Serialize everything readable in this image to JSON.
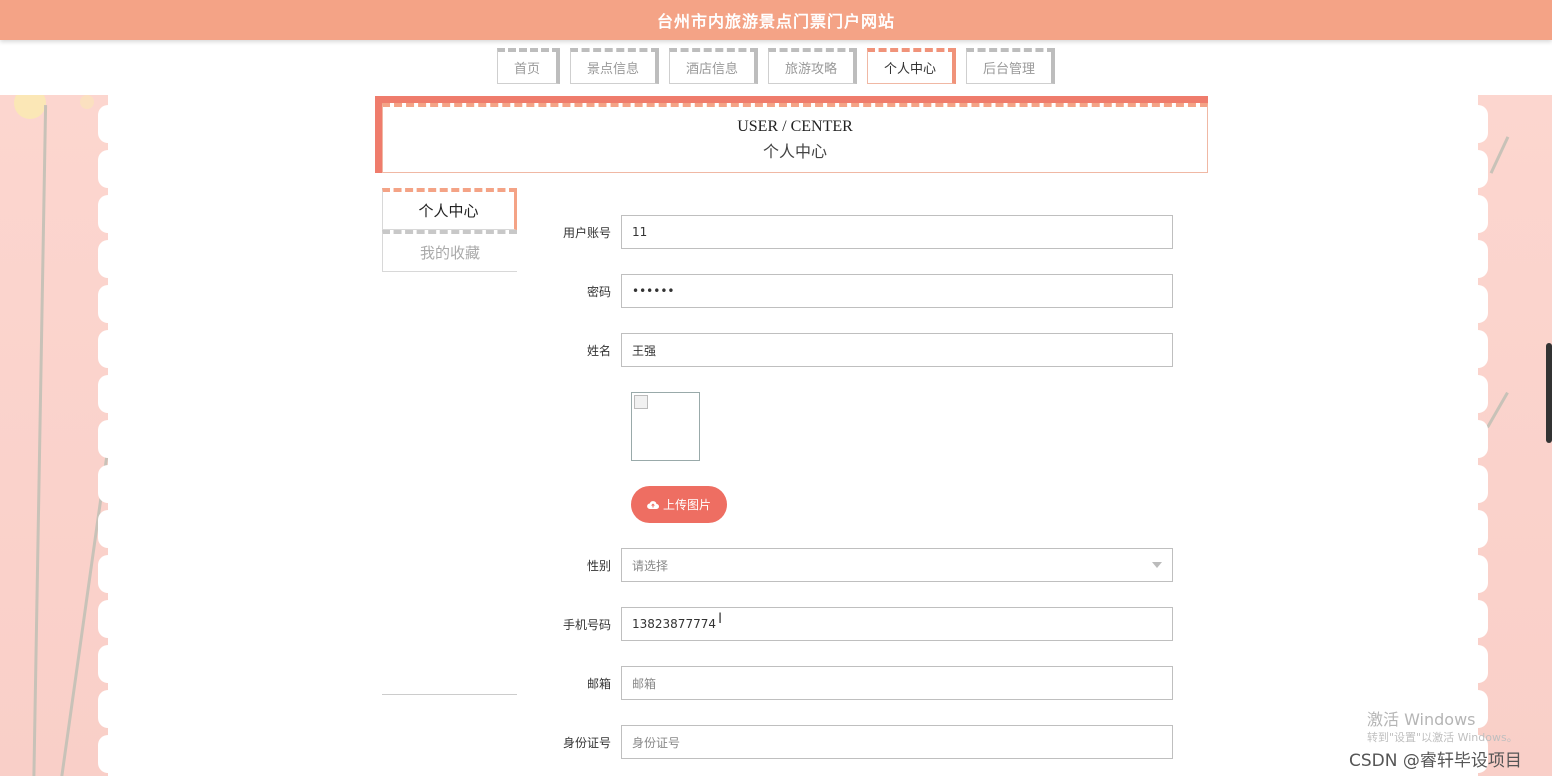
{
  "site": {
    "title": "台州市内旅游景点门票门户网站"
  },
  "nav": {
    "tabs": [
      {
        "label": "首页"
      },
      {
        "label": "景点信息"
      },
      {
        "label": "酒店信息"
      },
      {
        "label": "旅游攻略"
      },
      {
        "label": "个人中心",
        "active": true
      },
      {
        "label": "后台管理"
      }
    ]
  },
  "header": {
    "title_en": "USER / CENTER",
    "title_cn": "个人中心"
  },
  "submenu": {
    "items": [
      {
        "label": "个人中心",
        "active": true
      },
      {
        "label": "我的收藏"
      }
    ]
  },
  "form": {
    "account": {
      "label": "用户账号",
      "value": "11"
    },
    "password": {
      "label": "密码",
      "value": "••••••"
    },
    "name": {
      "label": "姓名",
      "value": "王强"
    },
    "upload": {
      "label": "上传图片",
      "icon": "cloud-upload-icon"
    },
    "gender": {
      "label": "性别",
      "placeholder": "请选择"
    },
    "phone": {
      "label": "手机号码",
      "value": "13823877774"
    },
    "email": {
      "label": "邮箱",
      "placeholder": "邮箱"
    },
    "idcard": {
      "label": "身份证号",
      "placeholder": "身份证号"
    }
  },
  "watermark": {
    "line1": "激活 Windows",
    "line2": "转到\"设置\"以激活 Windows。",
    "csdn": "CSDN @睿轩毕设项目"
  },
  "colors": {
    "topbar": "#f4a386",
    "accent": "#ef7c6c",
    "button": "#ee6e62",
    "side": "#fcd6cf"
  }
}
